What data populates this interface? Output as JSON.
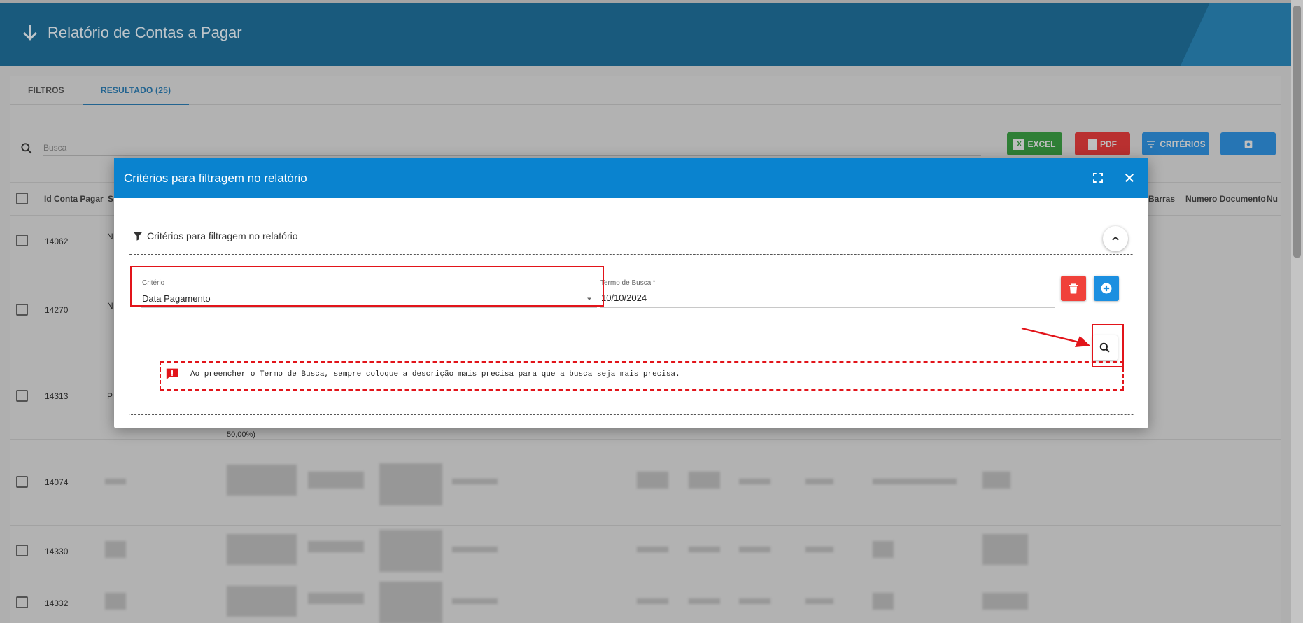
{
  "header": {
    "title": "Relatório de Contas a Pagar",
    "icon": "arrow-down-icon"
  },
  "tabs": [
    {
      "label": "FILTROS",
      "active": false
    },
    {
      "label": "RESULTADO (25)",
      "active": true
    }
  ],
  "search": {
    "placeholder": "Busca",
    "value": ""
  },
  "actions": {
    "excel_label": "EXCEL",
    "pdf_label": "PDF",
    "criterios_label": "CRITÉRIOS",
    "settings_icon": "gear-icon",
    "colors": {
      "excel": "#3a9b43",
      "pdf": "#e23b3b",
      "criterios": "#2f8fdc",
      "settings": "#2f8fdc"
    }
  },
  "table": {
    "columns": [
      "Id Conta Pagar",
      "S",
      "Barras",
      "Numero Documento",
      "Nu"
    ],
    "rows": [
      {
        "id": "14062",
        "text": "N"
      },
      {
        "id": "14270",
        "text": "N"
      },
      {
        "id": "14313",
        "text": "P"
      },
      {
        "id": "14074",
        "text": ""
      },
      {
        "id": "14330",
        "text": ""
      },
      {
        "id": "14332",
        "text": ""
      }
    ],
    "partial_text": "50,00%)"
  },
  "modal": {
    "title": "Critérios para filtragem no relatório",
    "section_title": "Critérios para filtragem no relatório",
    "criterio": {
      "label": "Critério",
      "value": "Data Pagamento"
    },
    "termo": {
      "label": "Termo de Busca",
      "required_mark": "*",
      "value": "10/10/2024"
    },
    "notice": "Ao preencher o Termo de Busca, sempre coloque a descrição mais precisa para que a busca seja mais precisa.",
    "colors": {
      "header": "#0a83cf",
      "delete": "#f0413a",
      "add": "#1b8fe0",
      "annotation": "#e2141a"
    }
  }
}
